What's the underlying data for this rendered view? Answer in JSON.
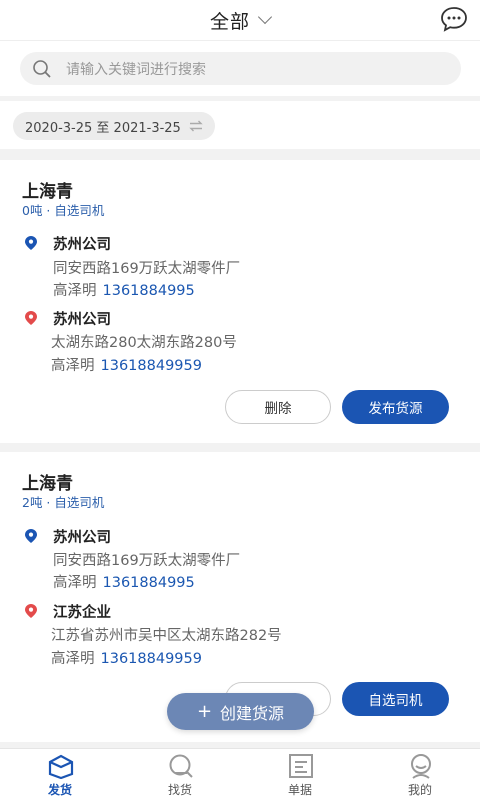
{
  "header": {
    "title": "全部"
  },
  "search": {
    "placeholder": "请输入关键词进行搜索"
  },
  "date_filter": {
    "label": "2020-3-25 至 2021-3-25"
  },
  "cards": [
    {
      "owner": "上海青",
      "meta": "0吨 · 自选司机",
      "from": {
        "name": "苏州公司",
        "address": "同安西路169万跃太湖零件厂",
        "person": "高泽明",
        "phone": "1361884995"
      },
      "to": {
        "name": "苏州公司",
        "address": "太湖东路280太湖东路280号",
        "person": "高泽明",
        "phone": "13618849959"
      },
      "secondary_button": "删除",
      "primary_button": "发布货源"
    },
    {
      "owner": "上海青",
      "meta": "2吨 · 自选司机",
      "from": {
        "name": "苏州公司",
        "address": "同安西路169万跃太湖零件厂",
        "person": "高泽明",
        "phone": "1361884995"
      },
      "to": {
        "name": "江苏企业",
        "address": "江苏省苏州市吴中区太湖东路282号",
        "person": "高泽明",
        "phone": "13618849959"
      },
      "primary_button": "自选司机"
    }
  ],
  "fab": {
    "plus": "+",
    "label": "创建货源"
  },
  "tabs": [
    {
      "label": "发货",
      "icon": "ship-box-icon",
      "active": true
    },
    {
      "label": "找货",
      "icon": "find-cargo-icon",
      "active": false
    },
    {
      "label": "单据",
      "icon": "document-icon",
      "active": false
    },
    {
      "label": "我的",
      "icon": "profile-icon",
      "active": false
    }
  ],
  "colors": {
    "accent": "#1b55b3",
    "fab": "#6c87b5",
    "origin_pin": "#1b55b3",
    "destination_pin": "#e34b4b"
  }
}
